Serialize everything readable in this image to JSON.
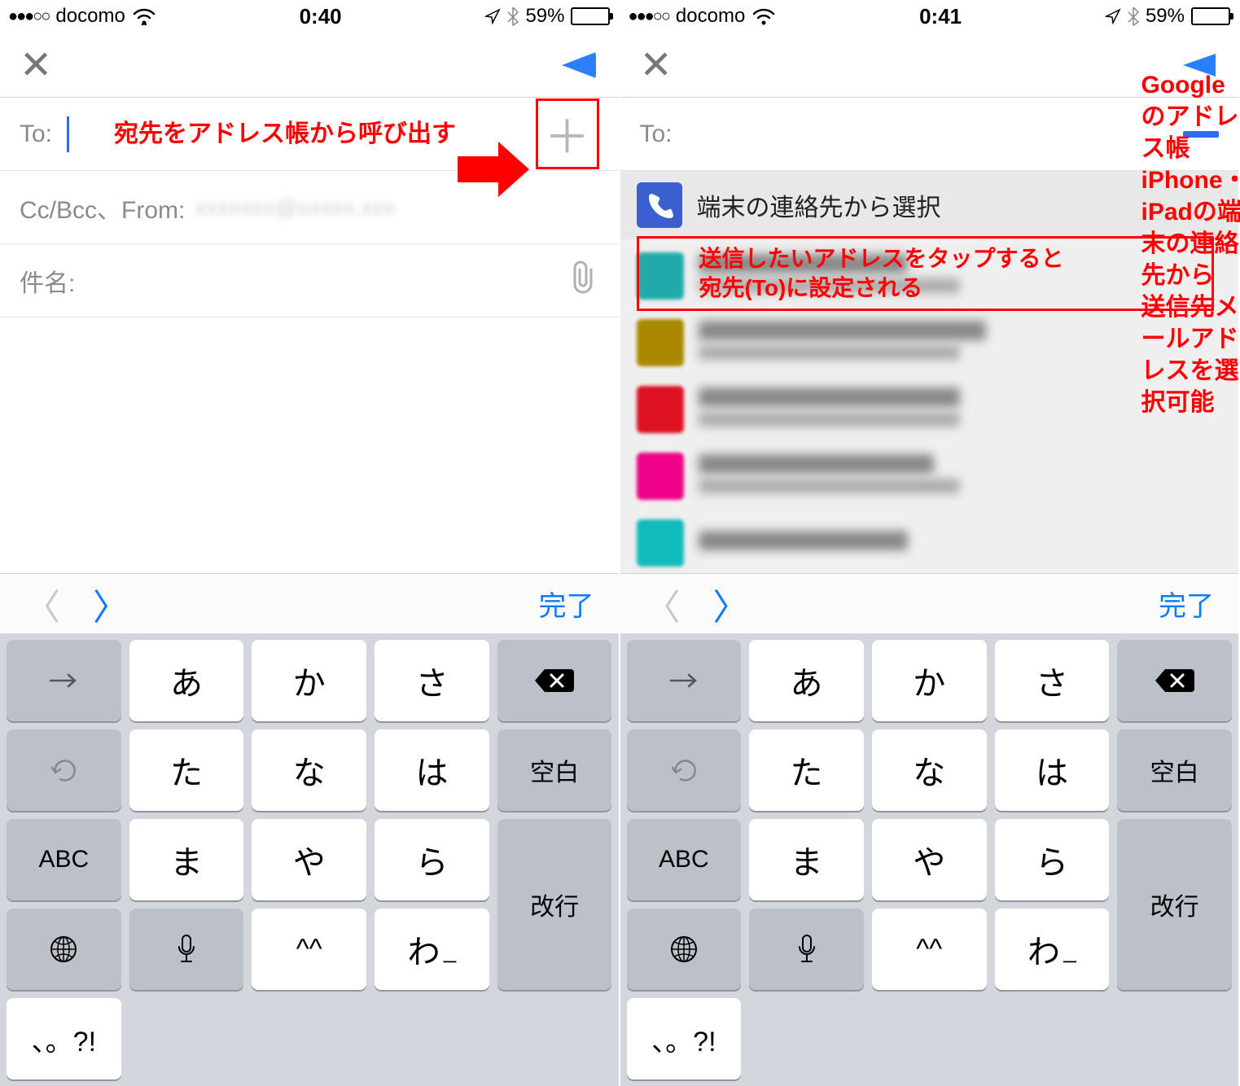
{
  "left": {
    "status": {
      "carrier": "docomo",
      "time": "0:40",
      "battery_pct": "59%"
    },
    "to_label": "To:",
    "annotation1": "宛先をアドレス帳から呼び出す",
    "cc_label": "Cc/Bcc、From:",
    "subject_label": "件名:"
  },
  "right": {
    "status": {
      "carrier": "docomo",
      "time": "0:41",
      "battery_pct": "59%"
    },
    "to_label": "To:",
    "annotation_top": "Googleのアドレス帳\niPhone・iPadの端末の連絡先から\n送信先メールアドレスを選択可能",
    "contact_device": "端末の連絡先から選択",
    "annotation_box": "送信したいアドレスをタップすると\n宛先(To)に設定される"
  },
  "keyboard": {
    "done": "完了",
    "rows": [
      [
        "→",
        "あ",
        "か",
        "さ",
        "⌫"
      ],
      [
        "↶",
        "た",
        "な",
        "は",
        "空白"
      ],
      [
        "ABC",
        "ま",
        "や",
        "ら",
        "改行"
      ],
      [
        "🌐",
        "🎤",
        "^^",
        "わ",
        "、。?!",
        ""
      ]
    ],
    "abc": "ABC",
    "space": "空白",
    "enter": "改行",
    "kana": [
      "あ",
      "か",
      "さ",
      "た",
      "な",
      "は",
      "ま",
      "や",
      "ら",
      "^^",
      "わ",
      "、。?!"
    ],
    "small_wa_sub": "ー"
  }
}
